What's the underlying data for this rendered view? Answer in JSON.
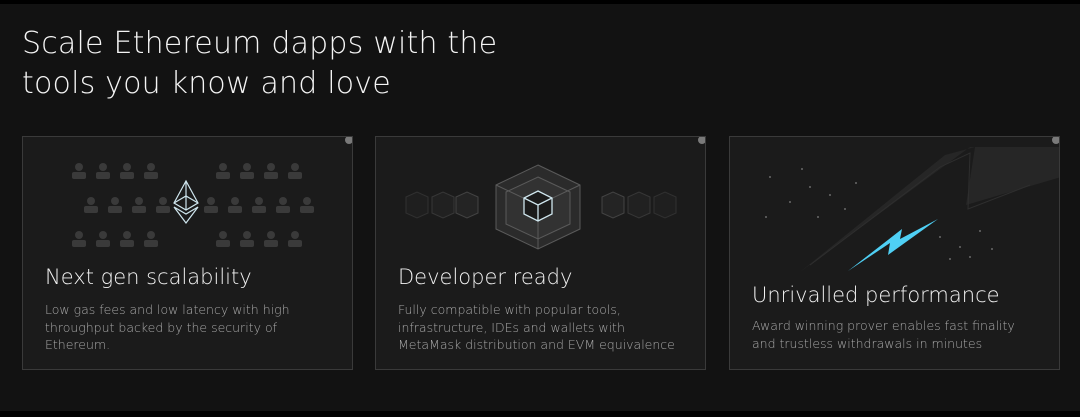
{
  "headline": {
    "line1": "Scale Ethereum dapps with the",
    "line2": "tools you know and love"
  },
  "cards": [
    {
      "title": "Next gen scalability",
      "lines": [
        "Low gas fees and low latency with high",
        "throughput backed by the security of",
        "Ethereum."
      ],
      "art_icon": "ethereum-crowd-icon"
    },
    {
      "title": "Developer ready",
      "lines": [
        "Fully compatible with popular tools,",
        "infrastructure, IDEs and wallets with",
        "MetaMask distribution and EVM equivalence"
      ],
      "art_icon": "cube-network-icon"
    },
    {
      "title": "Unrivalled performance",
      "lines": [
        "Award winning prover enables fast finality",
        "and trustless withdrawals in minutes"
      ],
      "art_icon": "lightning-bolt-icon"
    }
  ],
  "colors": {
    "background": "#121212",
    "card": "#1b1b1b",
    "accent_bolt": "#4fd0f5"
  }
}
